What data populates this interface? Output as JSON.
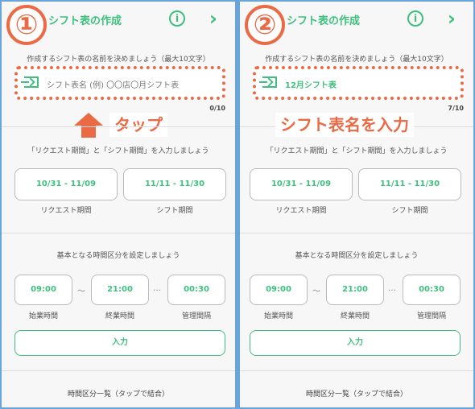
{
  "panels": [
    {
      "step": "①",
      "header": {
        "title": "シフト表の作成",
        "info": "i",
        "next": "›"
      },
      "name_prompt": "作成するシフト表の名前を決めましょう（最大10文字）",
      "name_field": {
        "value": "",
        "placeholder": "シフト表名 (例) 〇〇店〇月シフト表",
        "display": "シフト表名 (例) 〇〇店〇月シフト表",
        "counter": "0/10"
      },
      "annotation": "タップ",
      "period_prompt": "「リクエスト期間」と「シフト期間」を入力しましょう",
      "request_period": {
        "value": "10/31 - 11/09",
        "label": "リクエスト期間"
      },
      "shift_period": {
        "value": "11/11 - 11/30",
        "label": "シフト期間"
      },
      "time_prompt": "基本となる時間区分を設定しましょう",
      "start_time": {
        "value": "09:00",
        "label": "始業時間"
      },
      "end_time": {
        "value": "21:00",
        "label": "終業時間"
      },
      "interval": {
        "value": "00:30",
        "label": "管理間隔"
      },
      "tilde": "〜",
      "dots": "…",
      "input_button": "入力",
      "list_title": "時間区分一覧（タップで結合）"
    },
    {
      "step": "②",
      "header": {
        "title": "シフト表の作成",
        "info": "i",
        "next": "›"
      },
      "name_prompt": "作成するシフト表の名前を決めましょう（最大10文字）",
      "name_field": {
        "value": "12月シフト表",
        "placeholder": "",
        "display": "12月シフト表",
        "counter": "7/10"
      },
      "annotation": "シフト表名を入力",
      "period_prompt": "「リクエスト期間」と「シフト期間」を入力しましょう",
      "request_period": {
        "value": "10/31 - 11/09",
        "label": "リクエスト期間"
      },
      "shift_period": {
        "value": "11/11 - 11/30",
        "label": "シフト期間"
      },
      "time_prompt": "基本となる時間区分を設定しましょう",
      "start_time": {
        "value": "09:00",
        "label": "始業時間"
      },
      "end_time": {
        "value": "21:00",
        "label": "終業時間"
      },
      "interval": {
        "value": "00:30",
        "label": "管理間隔"
      },
      "tilde": "〜",
      "dots": "…",
      "input_button": "入力",
      "list_title": "時間区分一覧（タップで結合）"
    }
  ],
  "colors": {
    "accent": "#3fbf7f",
    "highlight": "#ea6a46",
    "frame": "#6aa5d9"
  }
}
